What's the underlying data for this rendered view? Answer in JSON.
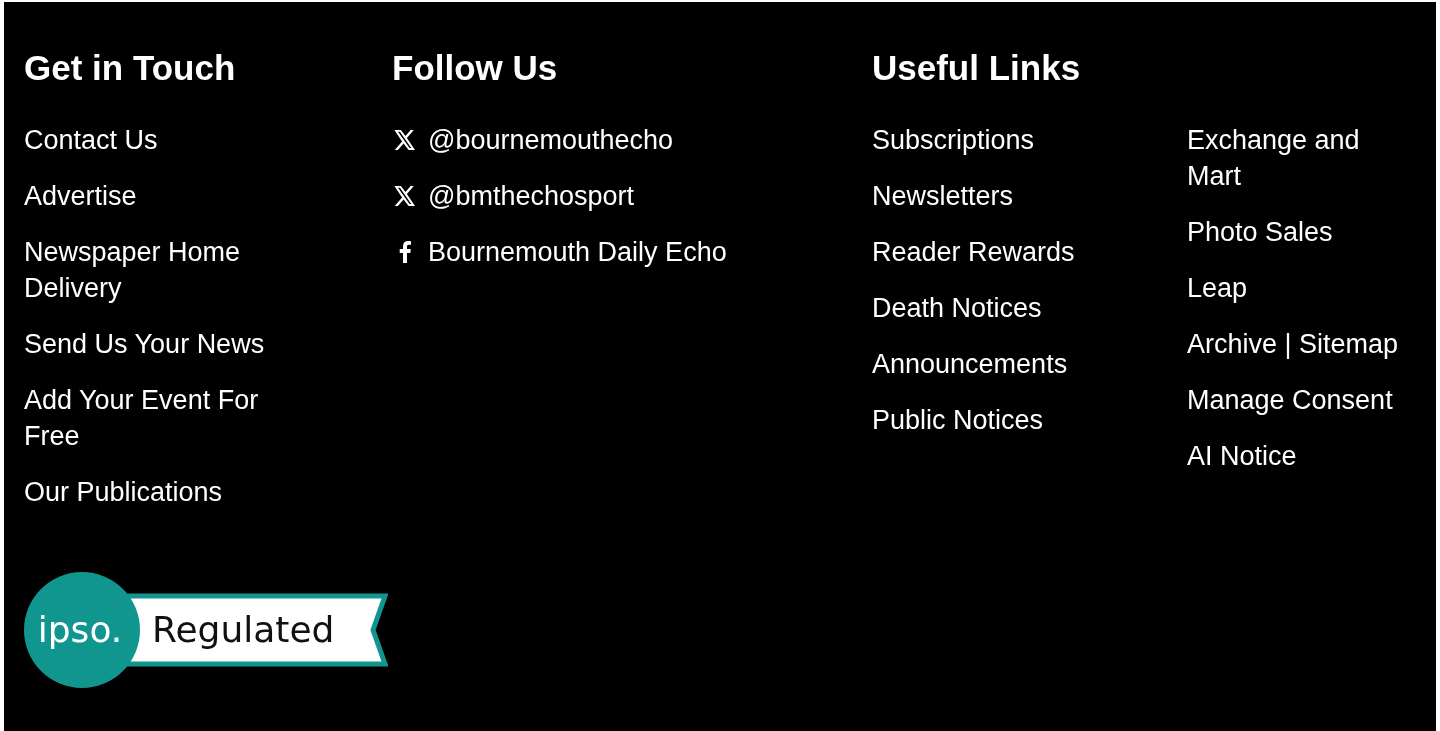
{
  "get_in_touch": {
    "title": "Get in Touch",
    "links": [
      "Contact Us",
      "Advertise",
      "Newspaper Home Delivery",
      "Send Us Your News",
      "Add Your Event For Free",
      "Our Publications"
    ]
  },
  "follow_us": {
    "title": "Follow Us",
    "links": [
      {
        "kind": "x",
        "label": "@bournemouthecho"
      },
      {
        "kind": "x",
        "label": "@bmthechosport"
      },
      {
        "kind": "facebook",
        "label": "Bournemouth Daily Echo"
      }
    ]
  },
  "useful_links": {
    "title": "Useful Links",
    "columns": [
      [
        "Subscriptions",
        "Newsletters",
        "Reader Rewards",
        "Death Notices",
        "Announcements",
        "Public Notices"
      ],
      [
        "Exchange and Mart",
        "Photo Sales",
        "Leap",
        "Archive | Sitemap",
        "Manage Consent",
        "AI Notice"
      ]
    ]
  },
  "badge": {
    "mark": "ipso.",
    "label": "Regulated"
  }
}
